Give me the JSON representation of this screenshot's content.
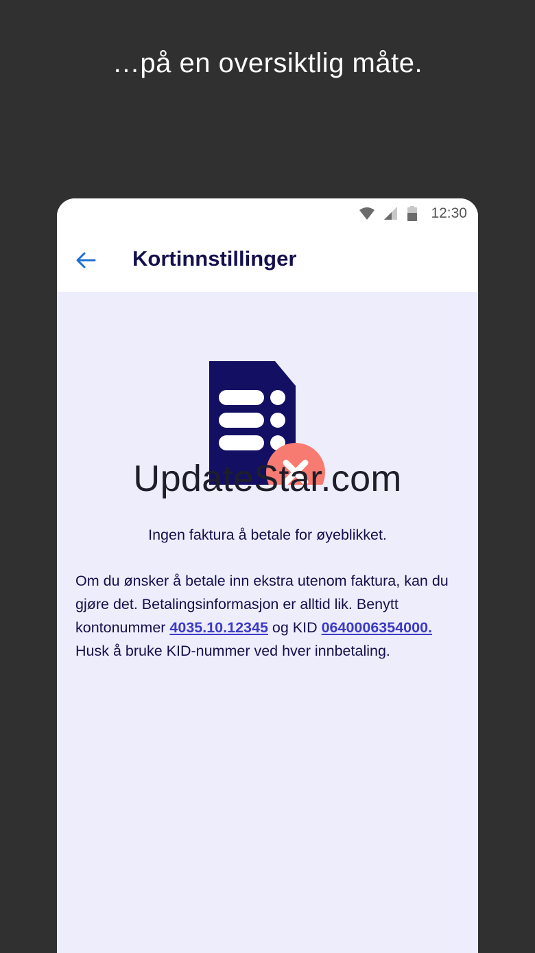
{
  "promo": {
    "caption": "…på en oversiktlig måte."
  },
  "status_bar": {
    "time": "12:30",
    "icons": [
      "wifi-icon",
      "signal-icon",
      "battery-icon"
    ]
  },
  "app_bar": {
    "back_icon": "arrow-left-icon",
    "title": "Kortinnstillinger"
  },
  "empty_state": {
    "icon": "document-error-icon",
    "watermark": "UpdateStar.com",
    "message": "Ingen faktura å betale for øyeblikket."
  },
  "info": {
    "text_1": "Om du ønsker å betale inn ekstra utenom faktura, kan du gjøre det. Betalingsinformasjon er alltid lik. Benytt kontonummer ",
    "account_number": "4035.10.12345",
    "text_2": " og KID ",
    "kid_number": "0640006354000.",
    "text_3": " Husk å bruke KID-nummer ved hver innbetaling."
  },
  "colors": {
    "background": "#303030",
    "screen_bg": "#eeedfb",
    "title_text": "#13104d",
    "accent_blue": "#1f6fd0",
    "document_icon": "#130f63",
    "error_badge": "#f77b71",
    "link": "#3a3ac8"
  }
}
